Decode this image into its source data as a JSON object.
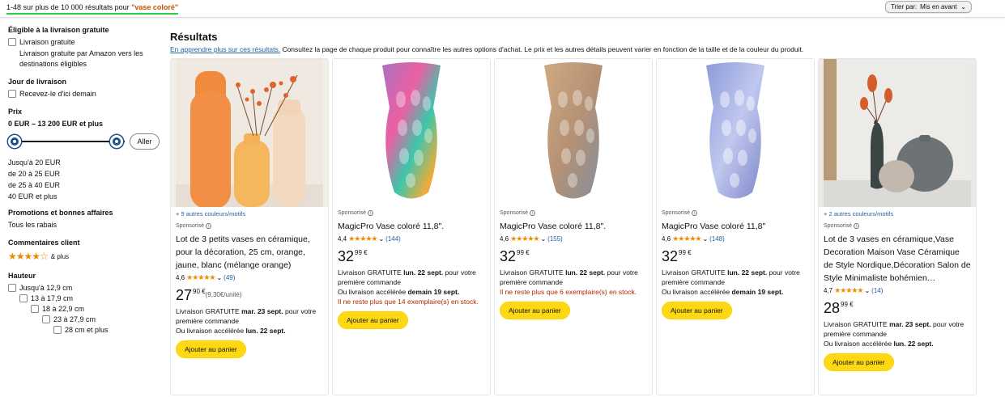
{
  "header": {
    "result_count": "1-48 sur plus de 10 000 résultats pour ",
    "query": "\"vase coloré\"",
    "sort_label": "Trier par:",
    "sort_value": "Mis en avant"
  },
  "sidebar": {
    "free_delivery_heading": "Éligible à la livraison gratuite",
    "free_delivery_option": "Livraison gratuite",
    "free_delivery_desc": "Livraison gratuite par Amazon vers les destinations éligibles",
    "delivery_day_heading": "Jour de livraison",
    "delivery_day_option": "Recevez-le d'ici demain",
    "price_heading": "Prix",
    "price_range": "0 EUR – 13 200 EUR et plus",
    "go_button": "Aller",
    "price_links": [
      "Jusqu'à 20 EUR",
      "de 20 à 25 EUR",
      "de 25 à 40 EUR",
      "40 EUR et plus"
    ],
    "promo_heading": "Promotions et bonnes affaires",
    "promo_option": "Tous les rabais",
    "reviews_heading": "Commentaires client",
    "reviews_stars": "★★★★☆",
    "reviews_option": "& plus",
    "height_heading": "Hauteur",
    "height_options": [
      "Jusqu'à 12,9 cm",
      "13 à 17,9 cm",
      "18 à 22,9 cm",
      "23 à 27,9 cm",
      "28 cm et plus"
    ]
  },
  "main": {
    "title": "Résultats",
    "learn_more": "En apprendre plus sur ces résultats.",
    "subtitle": " Consultez la page de chaque produit pour connaître les autres options d'achat. Le prix et les autres détails peuvent varier en fonction de la taille et de la couleur du produit."
  },
  "products": [
    {
      "colors": "+ 9 autres couleurs/motifs",
      "sponsored": "Sponsorisé",
      "title": "Lot de 3 petits vases en céramique, pour la décoration, 25 cm, orange, jaune, blanc (mélange orange)",
      "rating": "4,6",
      "stars": "★★★★★",
      "reviews": "(49)",
      "price_whole": "27",
      "price_frac": "90 €",
      "unit_price": "(9,30€/unité)",
      "delivery_1": "Livraison GRATUITE ",
      "delivery_1_date": "mar. 23 sept.",
      "delivery_1_tail": " pour votre première commande",
      "delivery_2": "Ou livraison accélérée ",
      "delivery_2_date": "lun. 22 sept.",
      "stock": "",
      "button": "Ajouter au panier"
    },
    {
      "colors": "",
      "sponsored": "Sponsorisé",
      "title": "MagicPro Vase coloré 11,8\".",
      "rating": "4,4",
      "stars": "★★★★★",
      "reviews": "(144)",
      "price_whole": "32",
      "price_frac": "99 €",
      "unit_price": "",
      "delivery_1": "Livraison GRATUITE ",
      "delivery_1_date": "lun. 22 sept.",
      "delivery_1_tail": " pour votre première commande",
      "delivery_2": "Ou livraison accélérée ",
      "delivery_2_date": "demain 19 sept.",
      "stock": "Il ne reste plus que 14 exemplaire(s) en stock.",
      "button": "Ajouter au panier"
    },
    {
      "colors": "",
      "sponsored": "Sponsorisé",
      "title": "MagicPro Vase coloré 11,8\".",
      "rating": "4,6",
      "stars": "★★★★★",
      "reviews": "(155)",
      "price_whole": "32",
      "price_frac": "99 €",
      "unit_price": "",
      "delivery_1": "Livraison GRATUITE ",
      "delivery_1_date": "lun. 22 sept.",
      "delivery_1_tail": " pour votre première commande",
      "delivery_2": "",
      "delivery_2_date": "",
      "stock": "Il ne reste plus que 6 exemplaire(s) en stock.",
      "button": "Ajouter au panier"
    },
    {
      "colors": "",
      "sponsored": "Sponsorisé",
      "title": "MagicPro Vase coloré 11,8\"",
      "rating": "4,6",
      "stars": "★★★★★",
      "reviews": "(148)",
      "price_whole": "32",
      "price_frac": "99 €",
      "unit_price": "",
      "delivery_1": "Livraison GRATUITE ",
      "delivery_1_date": "lun. 22 sept.",
      "delivery_1_tail": " pour votre première commande",
      "delivery_2": "Ou livraison accélérée ",
      "delivery_2_date": "demain 19 sept.",
      "stock": "",
      "button": "Ajouter au panier"
    },
    {
      "colors": "+ 2 autres couleurs/motifs",
      "sponsored": "Sponsorisé",
      "title": "Lot de 3 vases en céramique,Vase Decoration Maison Vase Céramique de Style Nordique,Décoration Salon de Style Minimaliste bohémien…",
      "rating": "4,7",
      "stars": "★★★★★",
      "reviews": "(14)",
      "price_whole": "28",
      "price_frac": "99 €",
      "unit_price": "",
      "delivery_1": "Livraison GRATUITE ",
      "delivery_1_date": "mar. 23 sept.",
      "delivery_1_tail": " pour votre première commande",
      "delivery_2": "Ou livraison accélérée ",
      "delivery_2_date": "lun. 22 sept.",
      "stock": "",
      "button": "Ajouter au panier"
    }
  ]
}
